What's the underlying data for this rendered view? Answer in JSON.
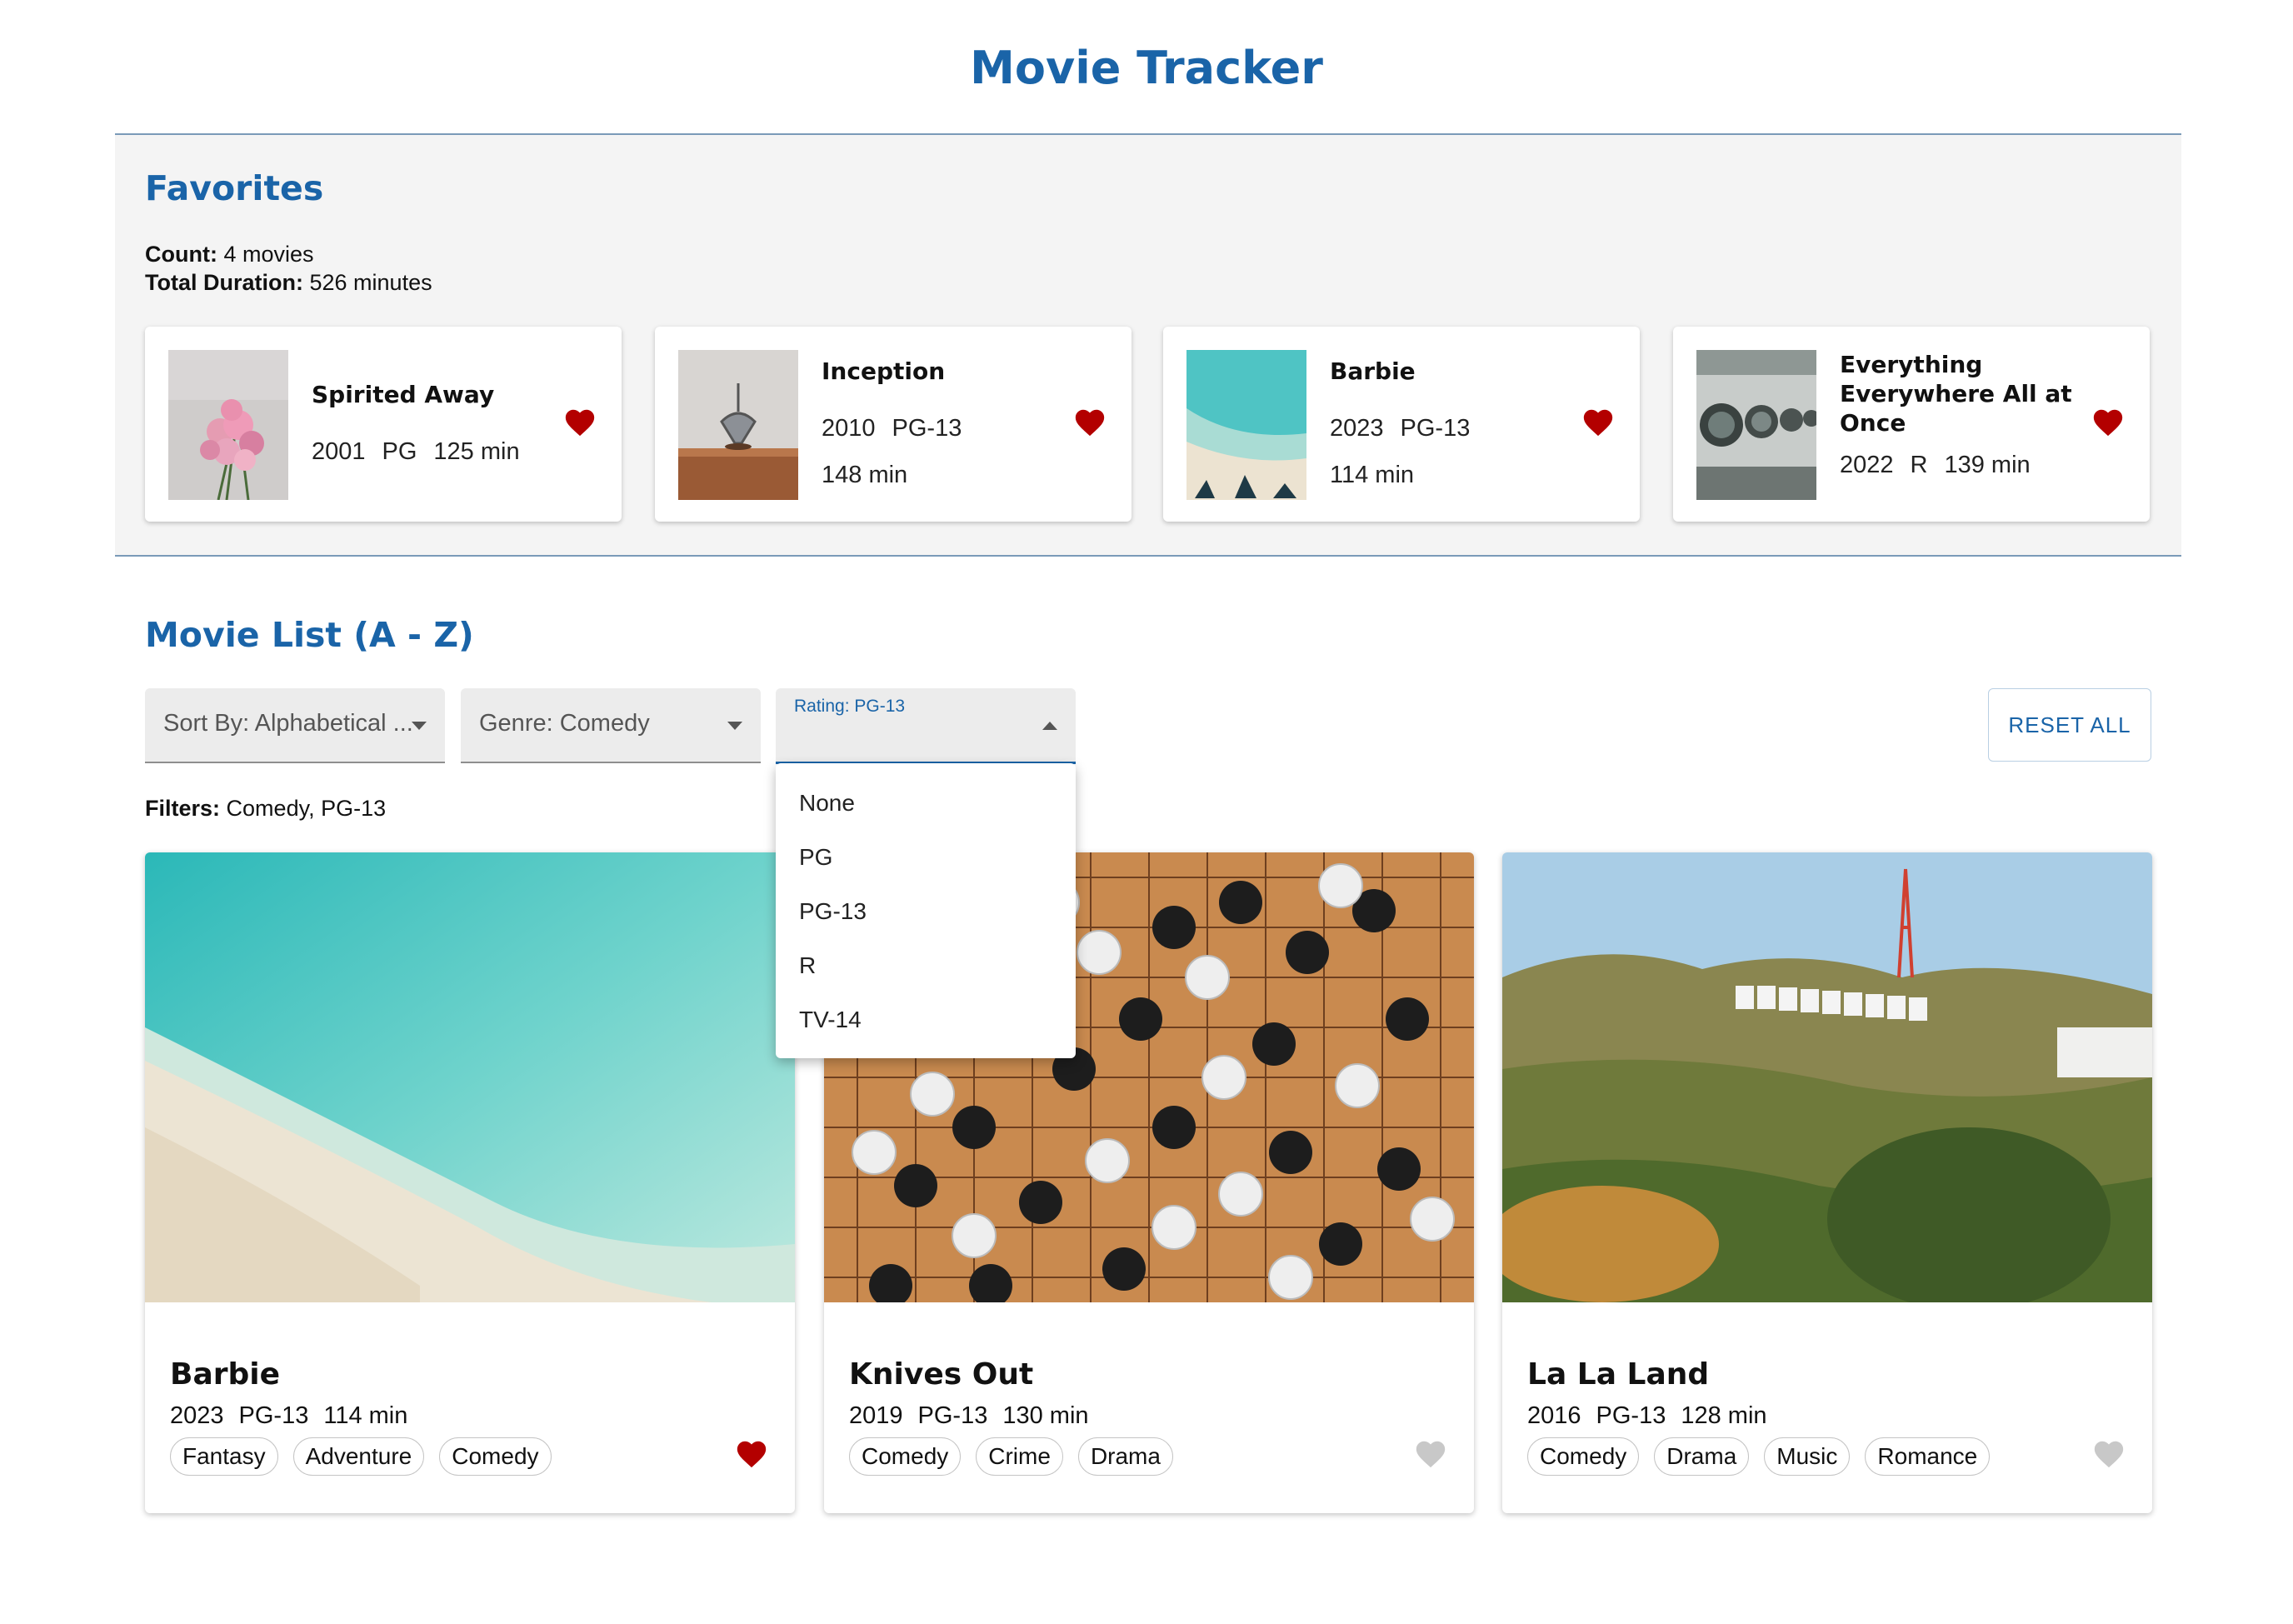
{
  "app": {
    "title": "Movie Tracker",
    "brand_color": "#1a64a8",
    "heart_active_color": "#b30000",
    "heart_inactive_color": "#c8c8c8"
  },
  "favorites": {
    "heading": "Favorites",
    "count_label": "Count:",
    "count_value": "4 movies",
    "duration_label": "Total Duration:",
    "duration_value": "526 minutes",
    "items": [
      {
        "title": "Spirited Away",
        "year": "2001",
        "rating": "PG",
        "duration": "125 min",
        "image": "pink-flowers-photo",
        "icon": "heart-icon",
        "favorited": true
      },
      {
        "title": "Inception",
        "year": "2010",
        "rating": "PG-13",
        "duration": "148 min",
        "image": "spinning-top-photo",
        "icon": "heart-icon",
        "favorited": true
      },
      {
        "title": "Barbie",
        "year": "2023",
        "rating": "PG-13",
        "duration": "114 min",
        "image": "beach-aerial-photo",
        "icon": "heart-icon",
        "favorited": true
      },
      {
        "title": "Everything Everywhere All at Once",
        "year": "2022",
        "rating": "R",
        "duration": "139 min",
        "image": "laundromat-photo",
        "icon": "heart-icon",
        "favorited": true
      }
    ]
  },
  "movie_list": {
    "heading": "Movie List (A - Z)",
    "sort": {
      "value": "Sort By: Alphabetical ..."
    },
    "genre": {
      "value": "Genre: Comedy"
    },
    "rating": {
      "label": "Rating: PG-13",
      "options": [
        "None",
        "PG",
        "PG-13",
        "R",
        "TV-14"
      ],
      "open": true
    },
    "reset_label": "RESET ALL",
    "filters_label": "Filters:",
    "filters_value": "Comedy, PG-13",
    "movies": [
      {
        "title": "Barbie",
        "year": "2023",
        "rating": "PG-13",
        "duration": "114 min",
        "genres": [
          "Fantasy",
          "Adventure",
          "Comedy"
        ],
        "favorited": true,
        "image": "beach-aerial-photo",
        "icon": "heart-icon"
      },
      {
        "title": "Knives Out",
        "year": "2019",
        "rating": "PG-13",
        "duration": "130 min",
        "genres": [
          "Comedy",
          "Crime",
          "Drama"
        ],
        "favorited": false,
        "image": "go-board-photo",
        "icon": "heart-icon"
      },
      {
        "title": "La La Land",
        "year": "2016",
        "rating": "PG-13",
        "duration": "128 min",
        "genres": [
          "Comedy",
          "Drama",
          "Music",
          "Romance"
        ],
        "favorited": false,
        "image": "hollywood-sign-photo",
        "icon": "heart-icon"
      }
    ]
  }
}
